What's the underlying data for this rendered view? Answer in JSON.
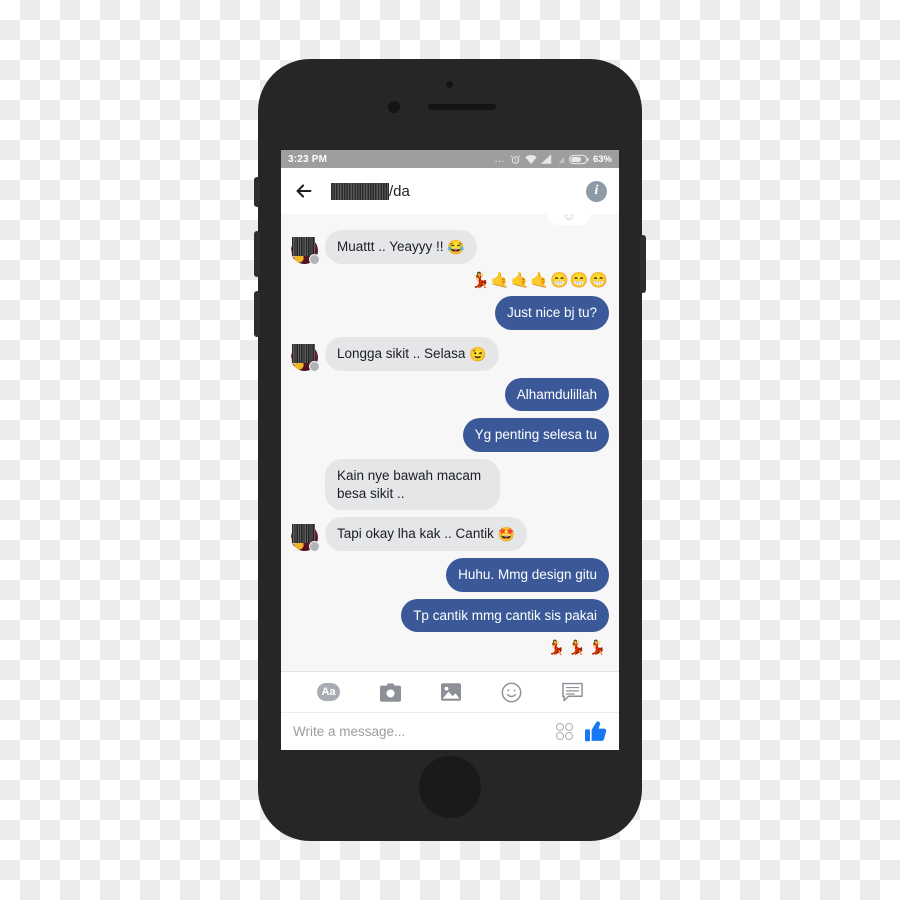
{
  "device": {
    "frame_color": "#262626",
    "home_button": "home-button",
    "buttons": [
      "silent-switch",
      "volume-down",
      "volume-up",
      "power"
    ]
  },
  "status_bar": {
    "time": "3:23 PM",
    "battery_percent": "63%",
    "icons": [
      "more-dots-icon",
      "alarm-clock-icon",
      "wifi-icon",
      "signal-bars-icon",
      "signal-bars-secondary-icon",
      "battery-icon"
    ],
    "background_color": "#9e9e9e"
  },
  "header": {
    "back_label": "back-arrow",
    "title_redacted": true,
    "title_suffix": "/da",
    "info_label": "i"
  },
  "chat": {
    "background_color": "#f7f7f7",
    "bubble_in_color": "#e4e6e8",
    "bubble_out_color": "#3b5998",
    "partial_top_bubble_emoji": "☺",
    "messages": [
      {
        "side": "in",
        "text": "Muattt .. Yeayyy !!",
        "emoji": "😂",
        "avatar": true
      },
      {
        "side": "out",
        "type": "emoji",
        "text": "💃🤙🤙🤙😁😁😁"
      },
      {
        "side": "out",
        "text": "Just nice bj tu?"
      },
      {
        "side": "in",
        "text": "Longga sikit .. Selasa",
        "emoji": "😉",
        "avatar": true
      },
      {
        "side": "out",
        "text": "Alhamdulillah"
      },
      {
        "side": "out",
        "text": "Yg penting selesa tu"
      },
      {
        "side": "in",
        "text": "Kain nye bawah macam besa sikit ..",
        "avatar": false
      },
      {
        "side": "in",
        "text": "Tapi okay lha kak .. Cantik",
        "emoji": "🤩",
        "avatar": true
      },
      {
        "side": "out",
        "text": "Huhu. Mmg design gitu"
      },
      {
        "side": "out",
        "text": "Tp cantik mmg cantik sis pakai"
      },
      {
        "side": "out",
        "type": "emoji",
        "text": "💃💃💃"
      }
    ]
  },
  "composer": {
    "tools": [
      {
        "name": "text-format-button",
        "label": "Aa"
      },
      {
        "name": "camera-button",
        "label": ""
      },
      {
        "name": "photo-gallery-button",
        "label": ""
      },
      {
        "name": "emoji-button",
        "label": ""
      },
      {
        "name": "sticker-button",
        "label": ""
      }
    ],
    "input_placeholder": "Write a message...",
    "input_value": "",
    "like_color": "#1877f2"
  }
}
